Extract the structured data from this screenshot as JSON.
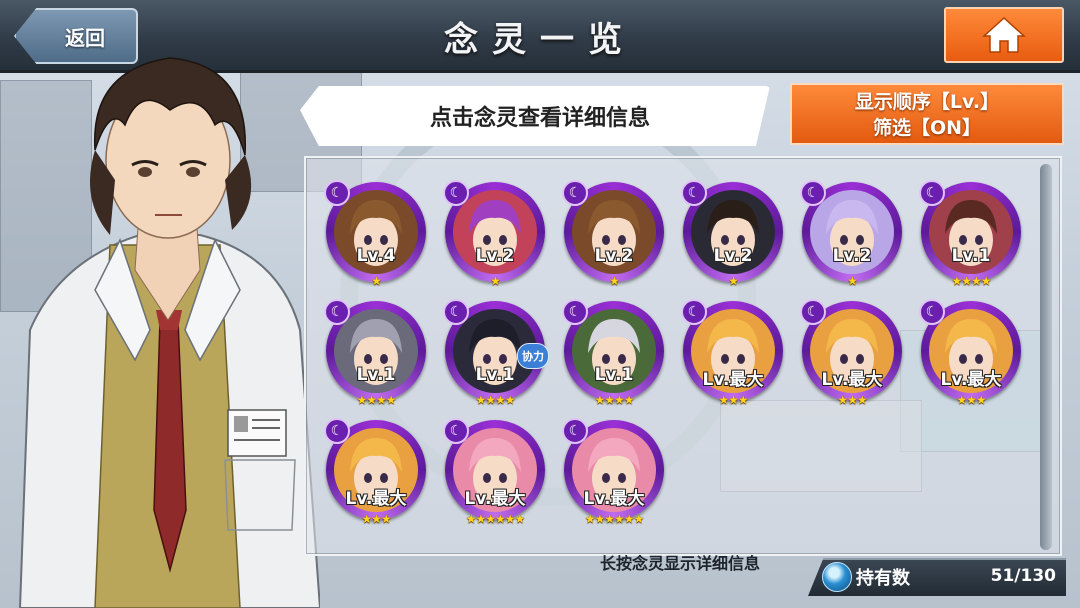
{
  "header": {
    "back_label": "返回",
    "title": "念灵一览",
    "home_icon": "home-icon"
  },
  "bubble": {
    "text": "点击念灵查看详细信息"
  },
  "sort_button": {
    "line1": "显示顺序【Lv.】",
    "line2": "筛选【ON】"
  },
  "units": [
    {
      "level": "Lv.4",
      "stars": "★",
      "portrait_color": "#7a4a2a",
      "hair": "#8a5a2e"
    },
    {
      "level": "Lv.2",
      "stars": "★",
      "portrait_color": "#c2425a",
      "hair": "#a040c0"
    },
    {
      "level": "Lv.2",
      "stars": "★",
      "portrait_color": "#7a4a2a",
      "hair": "#8a5a2e"
    },
    {
      "level": "Lv.2",
      "stars": "★",
      "portrait_color": "#2a2a35",
      "hair": "#2a1e18"
    },
    {
      "level": "Lv.2",
      "stars": "★",
      "portrait_color": "#b9a6e6",
      "hair": "#c9b8f0"
    },
    {
      "level": "Lv.1",
      "stars": "★★★★",
      "portrait_color": "#a0404a",
      "hair": "#5a2a22"
    },
    {
      "level": "Lv.1",
      "stars": "★★★★",
      "portrait_color": "#6a6a7a",
      "hair": "#a0a0b0"
    },
    {
      "level": "Lv.1",
      "stars": "★★★★",
      "portrait_color": "#2a2a3a",
      "hair": "#1e1e2a",
      "badge": "协力"
    },
    {
      "level": "Lv.1",
      "stars": "★★★★",
      "portrait_color": "#4a6a3a",
      "hair": "#d6d6e0"
    },
    {
      "level": "Lv.最大",
      "stars": "★★★",
      "portrait_color": "#e8a040",
      "hair": "#f4b84a"
    },
    {
      "level": "Lv.最大",
      "stars": "★★★",
      "portrait_color": "#e8a040",
      "hair": "#f4b84a"
    },
    {
      "level": "Lv.最大",
      "stars": "★★★",
      "portrait_color": "#e8a040",
      "hair": "#f4b84a"
    },
    {
      "level": "Lv.最大",
      "stars": "★★★",
      "portrait_color": "#e8a040",
      "hair": "#f4b84a"
    },
    {
      "level": "Lv.最大",
      "stars": "★★★★★★",
      "portrait_color": "#e88aa8",
      "hair": "#f4a8c0"
    },
    {
      "level": "Lv.最大",
      "stars": "★★★★★★",
      "portrait_color": "#e88aa8",
      "hair": "#f4a8c0"
    }
  ],
  "footer": {
    "hint": "长按念灵显示详细信息",
    "count_label": "持有数",
    "count_value": "51/130"
  }
}
